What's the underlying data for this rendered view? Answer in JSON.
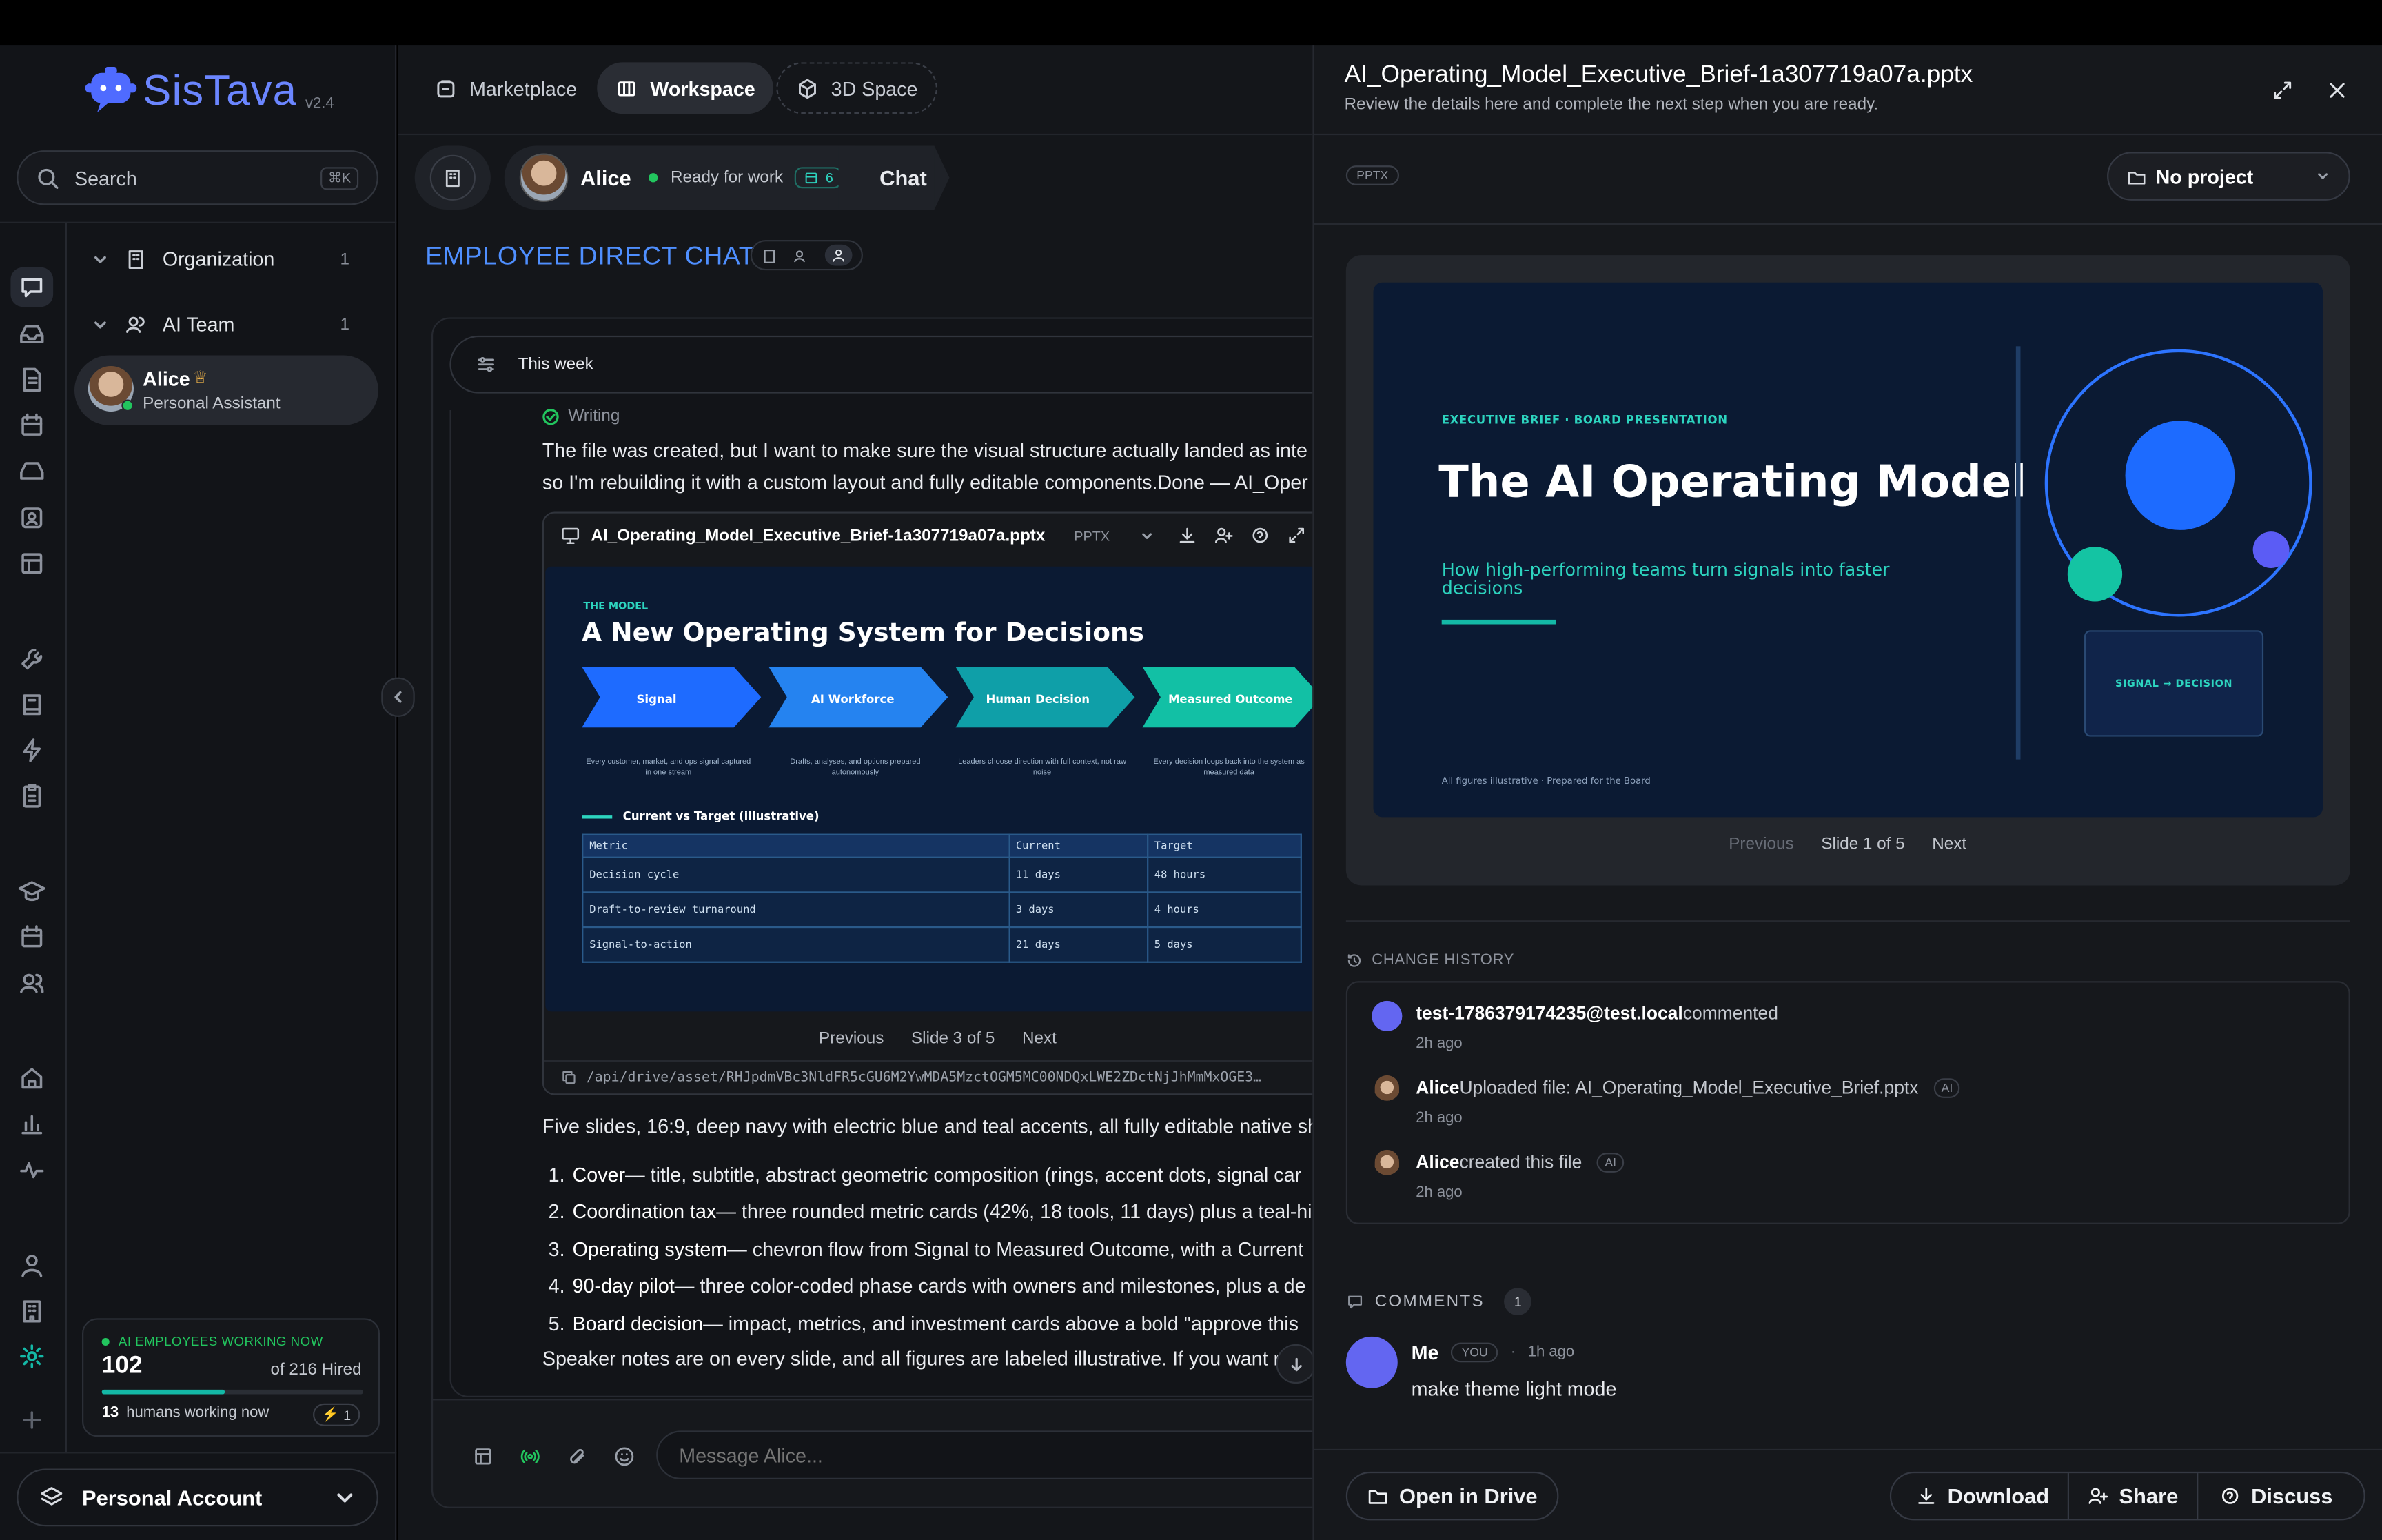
{
  "brand": {
    "name": "SisTava",
    "version": "v2.4"
  },
  "nav": {
    "marketplace": "Marketplace",
    "workspace": "Workspace",
    "space3d": "3D Space"
  },
  "search": {
    "label": "Search",
    "shortcut": "⌘K"
  },
  "tree": {
    "organization": {
      "label": "Organization",
      "count": "1"
    },
    "ai_team": {
      "label": "AI Team",
      "count": "1"
    },
    "employee": {
      "name": "Alice",
      "role": "Personal Assistant"
    }
  },
  "working": {
    "title": "AI EMPLOYEES WORKING NOW",
    "count": "102",
    "of_text": "of 216 Hired",
    "progress": 0.47,
    "humans_count": "13",
    "humans_text": "humans working now",
    "badge": "1"
  },
  "account": {
    "label": "Personal Account"
  },
  "chat_header": {
    "name": "Alice",
    "status": "Ready for work",
    "tasks": "6",
    "chat": "Chat"
  },
  "chat_title": "EMPLOYEE DIRECT CHAT",
  "filter": {
    "label": "This week"
  },
  "message": {
    "writing": "Writing",
    "line1": "The file was created, but I want to make sure the visual structure actually landed as inte",
    "line2": "so I'm rebuilding it with a custom layout and fully editable components.Done — AI_Oper",
    "file_name": "AI_Operating_Model_Executive_Brief-1a307719a07a.pptx",
    "file_type": "PPTX",
    "path": "/api/drive/asset/RHJpdmVBc3NldFR5cGU6M2YwMDA5MzctOGM5MC00NDQxLWE2ZDctNjJhMmMxOGE3…",
    "summary": "Five slides, 16:9, deep navy with electric blue and teal accents, all fully editable native sh",
    "items": [
      {
        "num": "1.",
        "title": "Cover",
        "text": " — title, subtitle, abstract geometric composition (rings, accent dots, signal car"
      },
      {
        "num": "2.",
        "title": "Coordination tax",
        "text": " — three rounded metric cards (42%, 18 tools, 11 days) plus a teal-hi"
      },
      {
        "num": "3.",
        "title": "Operating system",
        "text": " — chevron flow from Signal to Measured Outcome, with a Current"
      },
      {
        "num": "4.",
        "title": "90-day pilot",
        "text": " — three color-coded phase cards with owners and milestones, plus a de"
      },
      {
        "num": "5.",
        "title": "Board decision",
        "text": " — impact, metrics, and investment cards above a bold \"approve this"
      }
    ],
    "footer": "Speaker notes are on every slide, and all figures are labeled illustrative. If you want r"
  },
  "slide3": {
    "kicker": "THE MODEL",
    "title": "A New Operating System for Decisions",
    "chevrons": [
      "Signal",
      "AI Workforce",
      "Human Decision",
      "Measured Outcome"
    ],
    "captions": [
      "Every customer, market, and ops signal captured in one stream",
      "Drafts, analyses, and options prepared autonomously",
      "Leaders choose direction with full context, not raw noise",
      "Every decision loops back into the system as measured data"
    ],
    "table_title": "Current vs Target (illustrative)",
    "table": [
      [
        "Metric",
        "Current",
        "Target"
      ],
      [
        "Decision cycle",
        "11 days",
        "48 hours"
      ],
      [
        "Draft-to-review turnaround",
        "3 days",
        "4 hours"
      ],
      [
        "Signal-to-action",
        "21 days",
        "5 days"
      ]
    ],
    "nav": {
      "prev": "Previous",
      "label": "Slide 3 of 5",
      "next": "Next"
    }
  },
  "composer": {
    "placeholder": "Message Alice..."
  },
  "panel": {
    "title": "AI_Operating_Model_Executive_Brief-1a307719a07a.pptx",
    "subtitle": "Review the details here and complete the next step when you are ready.",
    "badge": "PPTX",
    "project": "No project",
    "slide1": {
      "kicker": "EXECUTIVE BRIEF · BOARD PRESENTATION",
      "title": "The AI Operating Model",
      "subtitle": "How high-performing teams turn signals into faster decisions",
      "footnote": "All figures illustrative · Prepared for the Board",
      "box": "SIGNAL → DECISION"
    },
    "slide_nav": {
      "prev": "Previous",
      "label": "Slide 1 of 5",
      "next": "Next"
    },
    "history_title": "CHANGE HISTORY",
    "history": [
      {
        "who": "test-1786379174235@test.local",
        "action": " commented",
        "ai": "",
        "time": "2h ago"
      },
      {
        "who": "Alice",
        "action": " Uploaded file: AI_Operating_Model_Executive_Brief.pptx",
        "ai": "AI",
        "time": "2h ago"
      },
      {
        "who": "Alice",
        "action": " created this file",
        "ai": "AI",
        "time": "2h ago"
      }
    ],
    "comments_title": "COMMENTS",
    "comments_count": "1",
    "comment": {
      "author": "Me",
      "you": "YOU",
      "time": "1h ago",
      "text": "make theme light mode"
    },
    "buttons": {
      "open": "Open in Drive",
      "download": "Download",
      "share": "Share",
      "discuss": "Discuss"
    }
  },
  "colors": {
    "accent": "#3b82f6",
    "teal": "#14b8a6",
    "navy": "#0b1a33",
    "green": "#22c55e"
  }
}
